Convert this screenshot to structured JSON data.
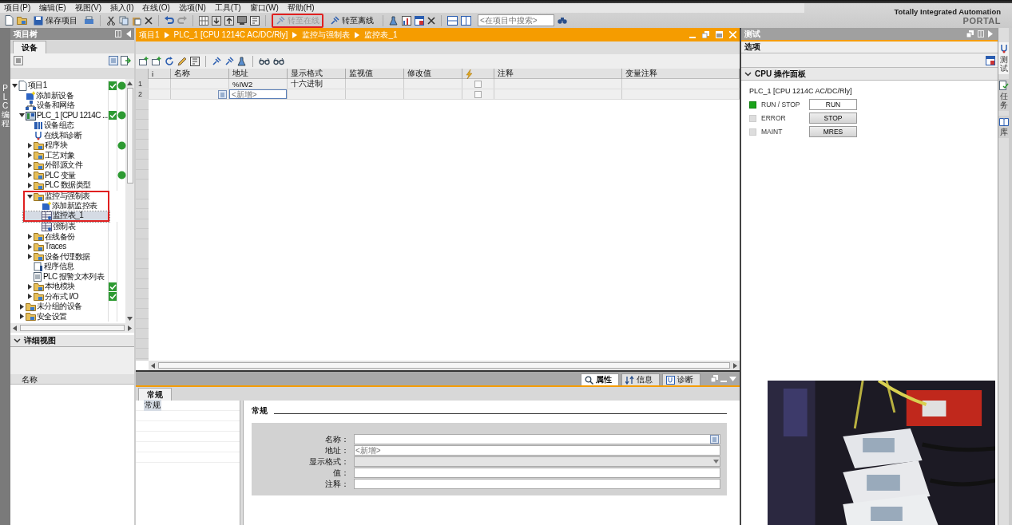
{
  "menu": [
    "项目(P)",
    "编辑(E)",
    "视图(V)",
    "插入(I)",
    "在线(O)",
    "选项(N)",
    "工具(T)",
    "窗口(W)",
    "帮助(H)"
  ],
  "toolbar": {
    "buttons": [
      {
        "label": "保存项目",
        "disabled": false,
        "marked": false
      },
      {
        "label": "转至在线",
        "disabled": true,
        "marked": true
      },
      {
        "label": "转至离线",
        "disabled": false,
        "marked": false
      }
    ],
    "search": {
      "placeholder": "<在项目中搜索>"
    }
  },
  "brand": {
    "title": "Totally Integrated Automation",
    "subtitle": "PORTAL"
  },
  "left_strip": {
    "label": "PLC 编程"
  },
  "project_tree": {
    "title": "项目树",
    "tab": "设备",
    "items": [
      {
        "label": "项目1",
        "kind": "project",
        "selected": false,
        "expanded": true,
        "check": true,
        "online": true,
        "marked": false,
        "children": [
          {
            "label": "添加新设备",
            "kind": "add",
            "selected": false,
            "check": false,
            "online": false,
            "marked": false
          },
          {
            "label": "设备和网络",
            "kind": "network",
            "selected": false,
            "check": false,
            "online": false,
            "marked": false
          },
          {
            "label": "PLC_1 [CPU 1214C ...",
            "kind": "plc",
            "selected": false,
            "expanded": true,
            "check": true,
            "online": true,
            "marked": false,
            "children": [
              {
                "label": "设备组态",
                "kind": "config",
                "selected": false,
                "check": false,
                "online": false,
                "marked": false
              },
              {
                "label": "在线和诊断",
                "kind": "diag",
                "selected": false,
                "check": false,
                "online": false,
                "marked": false
              },
              {
                "label": "程序块",
                "kind": "folder",
                "selected": false,
                "expanded": false,
                "check": false,
                "online": true,
                "marked": false
              },
              {
                "label": "工艺对象",
                "kind": "folder",
                "selected": false,
                "expanded": false,
                "check": false,
                "online": false,
                "marked": false
              },
              {
                "label": "外部源文件",
                "kind": "folder",
                "selected": false,
                "expanded": false,
                "check": false,
                "online": false,
                "marked": false
              },
              {
                "label": "PLC 变量",
                "kind": "folder",
                "selected": false,
                "expanded": false,
                "check": false,
                "online": true,
                "marked": false
              },
              {
                "label": "PLC 数据类型",
                "kind": "folder",
                "selected": false,
                "expanded": false,
                "check": false,
                "online": false,
                "marked": false
              },
              {
                "label": "监控与强制表",
                "kind": "folder",
                "selected": false,
                "expanded": true,
                "check": false,
                "online": false,
                "marked": true,
                "children": [
                  {
                    "label": "添加新监控表",
                    "kind": "add",
                    "selected": false,
                    "check": false,
                    "online": false,
                    "marked": true
                  },
                  {
                    "label": "监控表_1",
                    "kind": "table",
                    "selected": true,
                    "check": false,
                    "online": false,
                    "marked": true
                  },
                  {
                    "label": "强制表",
                    "kind": "table",
                    "selected": false,
                    "check": false,
                    "online": false,
                    "marked": false
                  }
                ]
              },
              {
                "label": "在线备份",
                "kind": "folder",
                "selected": false,
                "expanded": false,
                "check": false,
                "online": false,
                "marked": false
              },
              {
                "label": "Traces",
                "kind": "folder",
                "selected": false,
                "expanded": false,
                "check": false,
                "online": false,
                "marked": false
              },
              {
                "label": "设备代理数据",
                "kind": "folder",
                "selected": false,
                "expanded": false,
                "check": false,
                "online": false,
                "marked": false
              },
              {
                "label": "程序信息",
                "kind": "info",
                "selected": false,
                "check": false,
                "online": false,
                "marked": false
              },
              {
                "label": "PLC 报警文本列表",
                "kind": "list",
                "selected": false,
                "check": false,
                "online": false,
                "marked": false
              },
              {
                "label": "本地模块",
                "kind": "folder",
                "selected": false,
                "expanded": false,
                "check": true,
                "online": false,
                "marked": false
              },
              {
                "label": "分布式 I/O",
                "kind": "folder",
                "selected": false,
                "expanded": false,
                "check": true,
                "online": false,
                "marked": false
              }
            ]
          },
          {
            "label": "未分组的设备",
            "kind": "folder",
            "selected": false,
            "expanded": false,
            "check": false,
            "online": false,
            "marked": false
          },
          {
            "label": "安全设置",
            "kind": "folder",
            "selected": false,
            "expanded": false,
            "check": false,
            "online": false,
            "marked": false
          }
        ]
      }
    ]
  },
  "details_view": {
    "title": "详细视图",
    "column": "名称"
  },
  "breadcrumb": [
    "项目1",
    "PLC_1 [CPU 1214C AC/DC/Rly]",
    "监控与强制表",
    "监控表_1"
  ],
  "watch_table": {
    "columns": [
      "i",
      "名称",
      "地址",
      "显示格式",
      "监视值",
      "修改值",
      "注释",
      "变量注释"
    ],
    "rows": [
      {
        "number": "1",
        "kind": "entry",
        "address": "%IW2",
        "display_format": "十六进制",
        "checked": false
      },
      {
        "number": "2",
        "kind": "new",
        "placeholder": "<新增>",
        "checked": false
      }
    ]
  },
  "inspector": {
    "tabs": [
      {
        "label": "属性",
        "selected": true
      },
      {
        "label": "信息",
        "selected": false
      },
      {
        "label": "诊断",
        "selected": false
      }
    ],
    "subtab": "常规",
    "nav": [
      {
        "label": "常规",
        "selected": true
      }
    ],
    "section": "常规",
    "fields": [
      {
        "label": "名称：",
        "kind": "browse",
        "disabled": false
      },
      {
        "label": "地址：",
        "kind": "text",
        "placeholder": "<新增>",
        "disabled": false
      },
      {
        "label": "显示格式：",
        "kind": "dropdown",
        "disabled": true
      },
      {
        "label": "值：",
        "kind": "text",
        "disabled": false
      },
      {
        "label": "注释：",
        "kind": "text",
        "disabled": false
      }
    ]
  },
  "test_panel": {
    "title": "测试",
    "options": "选项",
    "section": {
      "title": "CPU 操作面板",
      "expanded": true
    },
    "device": "PLC_1 [CPU 1214C AC/DC/Rly]",
    "leds": [
      {
        "label": "RUN / STOP",
        "on": true
      },
      {
        "label": "ERROR",
        "on": false
      },
      {
        "label": "MAINT",
        "on": false
      }
    ],
    "buttons": [
      {
        "label": "RUN",
        "selected": true
      },
      {
        "label": "STOP",
        "selected": false
      },
      {
        "label": "MRES",
        "selected": false
      }
    ]
  },
  "side_tabs": [
    {
      "label": "测试",
      "selected": true
    },
    {
      "label": "任务",
      "selected": false
    },
    {
      "label": "库",
      "selected": false
    }
  ]
}
